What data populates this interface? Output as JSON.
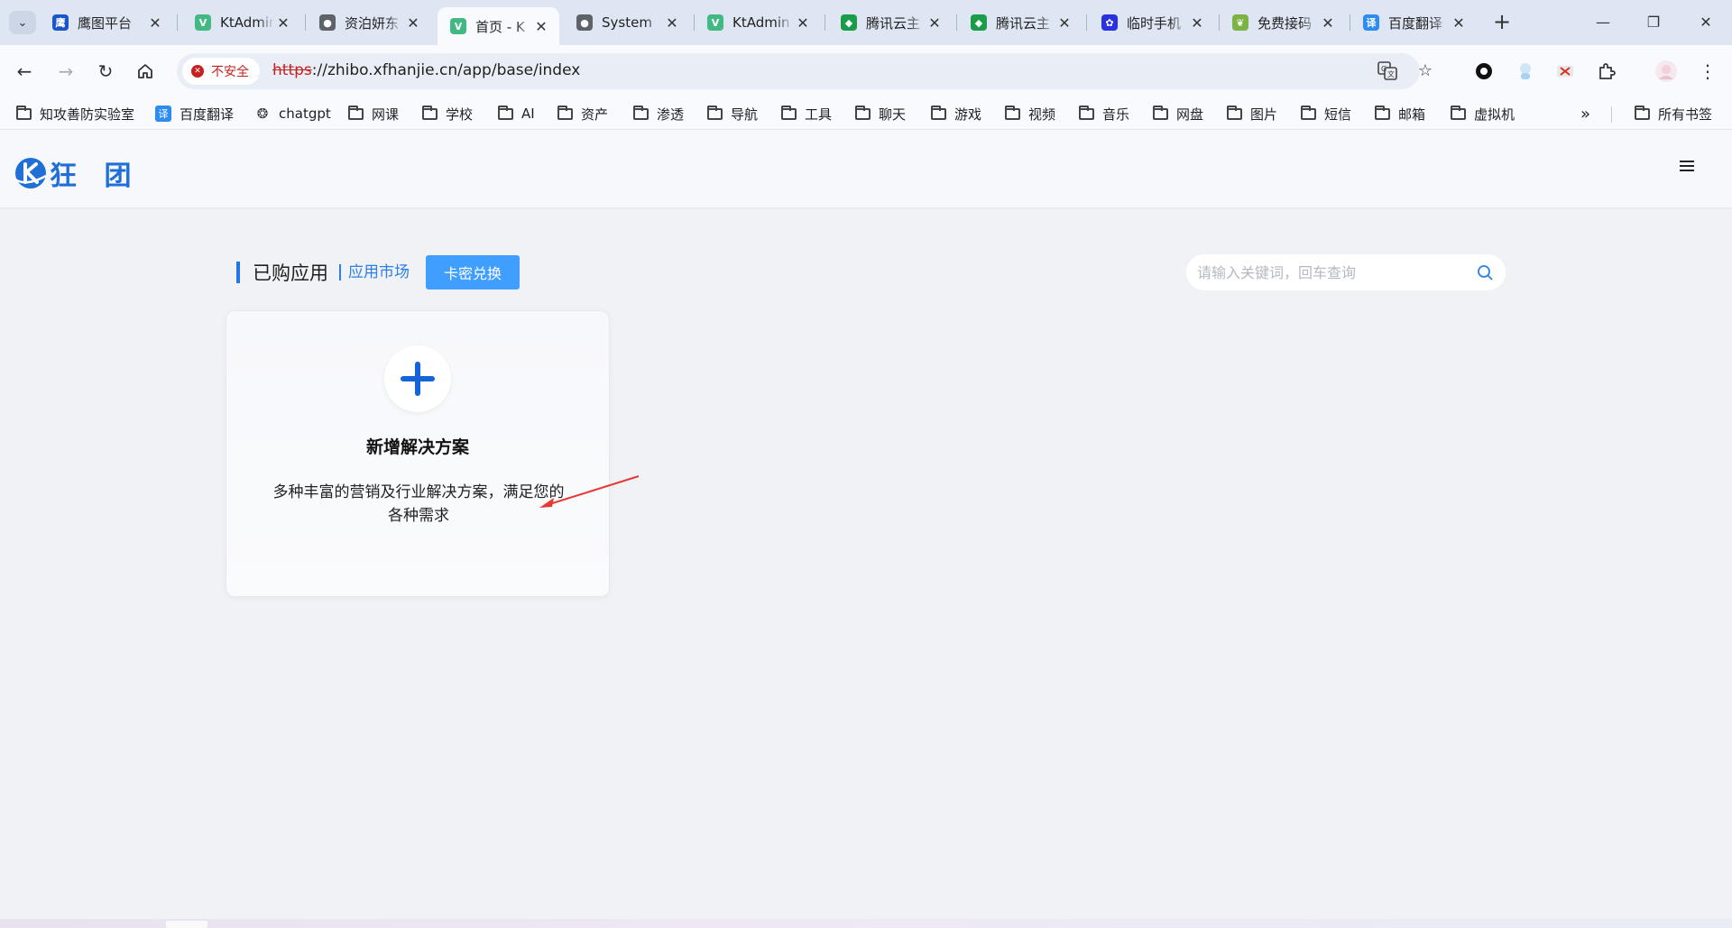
{
  "browser": {
    "tabs": [
      {
        "title": "鹰图平台",
        "favicon": "eagle-icon",
        "color": "#1a56c7"
      },
      {
        "title": "KtAdmin",
        "favicon": "vue-icon",
        "color": "#42b883"
      },
      {
        "title": "资泊妍东",
        "favicon": "globe-icon",
        "color": "#5f6368"
      },
      {
        "title": "首页 - K",
        "favicon": "vue-icon",
        "color": "#42b883",
        "active": true
      },
      {
        "title": "System",
        "favicon": "globe-icon",
        "color": "#5f6368"
      },
      {
        "title": "KtAdmin",
        "favicon": "vue-icon",
        "color": "#42b883"
      },
      {
        "title": "腾讯云主",
        "favicon": "shield-icon",
        "color": "#1b9c4a"
      },
      {
        "title": "腾讯云主",
        "favicon": "shield-icon",
        "color": "#1b9c4a"
      },
      {
        "title": "临时手机",
        "favicon": "paw-icon",
        "color": "#2932e1"
      },
      {
        "title": "免费接码",
        "favicon": "leaf-icon",
        "color": "#7cb342"
      },
      {
        "title": "百度翻译",
        "favicon": "translate-icon",
        "color": "#2d8cf0"
      }
    ],
    "omnibox": {
      "security_label": "不安全",
      "url_scheme": "https",
      "url_rest": "://zhibo.xfhanjie.cn/app/base/index"
    },
    "bookmarks": [
      {
        "label": "知攻善防实验室",
        "type": "folder"
      },
      {
        "label": "百度翻译",
        "type": "translate"
      },
      {
        "label": "chatgpt",
        "type": "openai"
      },
      {
        "label": "网课",
        "type": "folder"
      },
      {
        "label": "学校",
        "type": "folder"
      },
      {
        "label": "AI",
        "type": "folder"
      },
      {
        "label": "资产",
        "type": "folder"
      },
      {
        "label": "渗透",
        "type": "folder"
      },
      {
        "label": "导航",
        "type": "folder"
      },
      {
        "label": "工具",
        "type": "folder"
      },
      {
        "label": "聊天",
        "type": "folder"
      },
      {
        "label": "游戏",
        "type": "folder"
      },
      {
        "label": "视频",
        "type": "folder"
      },
      {
        "label": "音乐",
        "type": "folder"
      },
      {
        "label": "网盘",
        "type": "folder"
      },
      {
        "label": "图片",
        "type": "folder"
      },
      {
        "label": "短信",
        "type": "folder"
      },
      {
        "label": "邮箱",
        "type": "folder"
      },
      {
        "label": "虚拟机",
        "type": "folder"
      }
    ],
    "all_bookmarks_label": "所有书签",
    "more_bookmarks_label": "»"
  },
  "app": {
    "logo_text": "狂 团",
    "brand_color": "#1f6fd6"
  },
  "section": {
    "title": "已购应用",
    "market_link": "应用市场",
    "redeem_button": "卡密兑换"
  },
  "search": {
    "placeholder": "请输入关键词，回车查询"
  },
  "card": {
    "title": "新增解决方案",
    "description": "多种丰富的营销及行业解决方案，满足您的各种需求"
  },
  "colors": {
    "accent": "#409eff",
    "plus": "#1463d8",
    "arrow": "#e53935",
    "insecure": "#c5221f"
  }
}
